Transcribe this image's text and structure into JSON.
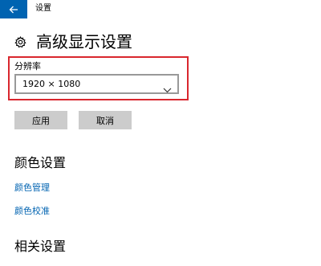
{
  "window": {
    "title": "设置"
  },
  "page": {
    "title": "高级显示设置"
  },
  "resolution": {
    "label": "分辨率",
    "value": "1920 × 1080"
  },
  "buttons": {
    "apply": "应用",
    "cancel": "取消"
  },
  "color_section": {
    "heading": "颜色设置",
    "links": [
      "颜色管理",
      "颜色校准"
    ]
  },
  "related_section": {
    "heading": "相关设置"
  },
  "colors": {
    "accent": "#0063b1",
    "highlight_border": "#d9272e",
    "button_bg": "#cccccc"
  }
}
